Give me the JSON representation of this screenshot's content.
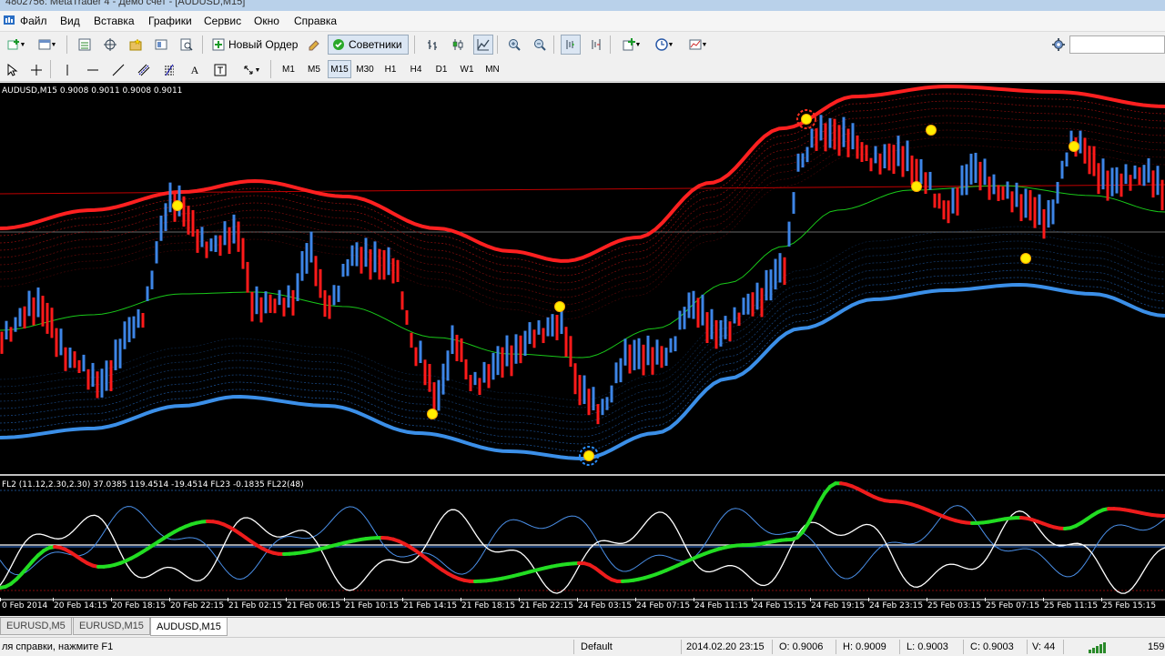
{
  "window": {
    "title": "4802756: MetaTrader 4 - Демо счет - [AUDUSD,M15]"
  },
  "menu": [
    "Файл",
    "Вид",
    "Вставка",
    "Графики",
    "Сервис",
    "Окно",
    "Справка"
  ],
  "toolbar": {
    "new_order_label": "Новый Ордер",
    "experts_label": "Советники",
    "timeframes": [
      "M1",
      "M5",
      "M15",
      "M30",
      "H1",
      "H4",
      "D1",
      "W1",
      "MN"
    ],
    "active_timeframe": "M15",
    "search_value": ""
  },
  "chart": {
    "header": "AUDUSD,M15  0.9008 0.9011 0.9008 0.9011",
    "indicator_header": "FL2 (11.12,2.30,2.30) 37.0385 119.4514 -19.4514  FL23 -0.1835  FL22(48)",
    "x_labels": [
      "0 Feb 2014",
      "20 Feb 14:15",
      "20 Feb 18:15",
      "20 Feb 22:15",
      "21 Feb 02:15",
      "21 Feb 06:15",
      "21 Feb 10:15",
      "21 Feb 14:15",
      "21 Feb 18:15",
      "21 Feb 22:15",
      "24 Feb 03:15",
      "24 Feb 07:15",
      "24 Feb 11:15",
      "24 Feb 15:15",
      "24 Feb 19:15",
      "24 Feb 23:15",
      "25 Feb 03:15",
      "25 Feb 07:15",
      "25 Feb 11:15",
      "25 Feb 15:15"
    ],
    "colors": {
      "background": "#000000",
      "bull_bar": "#3d85e6",
      "bear_bar": "#ff1a1a",
      "upper_band": "#ff2020",
      "lower_band": "#3b8fe8",
      "mid_line": "#19c819",
      "signal_dot": "#ffee00"
    }
  },
  "tabs": [
    "EURUSD,M5",
    "EURUSD,M15",
    "AUDUSD,M15"
  ],
  "active_tab": "AUDUSD,M15",
  "status": {
    "help": "ля справки, нажмите F1",
    "profile": "Default",
    "datetime": "2014.02.20 23:15",
    "open": "O: 0.9006",
    "high": "H: 0.9009",
    "low": "L: 0.9003",
    "close": "C: 0.9003",
    "volume": "V: 44",
    "traffic": "159"
  }
}
